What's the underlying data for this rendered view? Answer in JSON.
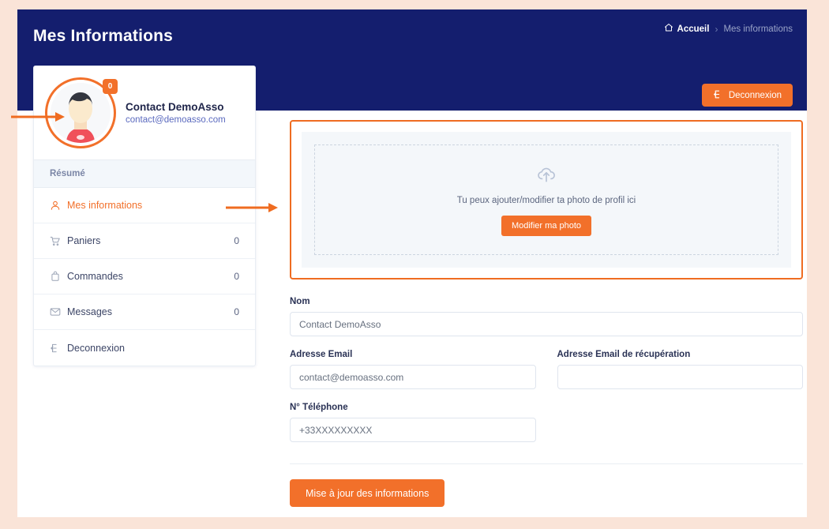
{
  "header": {
    "title": "Mes Informations",
    "breadcrumb": {
      "home_icon": "home-icon",
      "home_label": "Accueil",
      "separator": "›",
      "current": "Mes informations"
    },
    "logout_button": {
      "label": "Deconnexion",
      "icon": "logout-icon"
    }
  },
  "sidebar": {
    "profile": {
      "name": "Contact DemoAsso",
      "email": "contact@demoasso.com",
      "badge_count": "0",
      "avatar_icon": "user-avatar-illustration"
    },
    "section_label": "Résumé",
    "items": [
      {
        "label": "Mes informations",
        "count": "",
        "icon": "user-icon",
        "active": true
      },
      {
        "label": "Paniers",
        "count": "0",
        "icon": "cart-icon",
        "active": false
      },
      {
        "label": "Commandes",
        "count": "0",
        "icon": "bag-icon",
        "active": false
      },
      {
        "label": "Messages",
        "count": "0",
        "icon": "envelope-icon",
        "active": false
      },
      {
        "label": "Deconnexion",
        "count": "",
        "icon": "logout-icon",
        "active": false
      }
    ]
  },
  "main": {
    "upload": {
      "icon": "cloud-upload-icon",
      "text": "Tu peux ajouter/modifier ta photo de profil ici",
      "button_label": "Modifier ma photo"
    },
    "form": {
      "nom": {
        "label": "Nom",
        "value": "Contact DemoAsso",
        "placeholder": "Nom"
      },
      "email": {
        "label": "Adresse Email",
        "value": "contact@demoasso.com",
        "placeholder": "Adresse Email"
      },
      "email_recovery": {
        "label": "Adresse Email de récupération",
        "value": "",
        "placeholder": ""
      },
      "phone": {
        "label": "N° Téléphone",
        "value": "+33XXXXXXXXX",
        "placeholder": "N° Téléphone"
      },
      "submit_label": "Mise à jour des informations"
    }
  },
  "annotations": [
    {
      "name": "arrow-to-avatar",
      "direction": "right"
    },
    {
      "name": "arrow-to-upload-panel",
      "direction": "right"
    }
  ],
  "colors": {
    "accent_orange": "#f2702a",
    "header_navy": "#141e6e",
    "page_background": "#fae4d8",
    "panel_light": "#f4f7fa"
  }
}
